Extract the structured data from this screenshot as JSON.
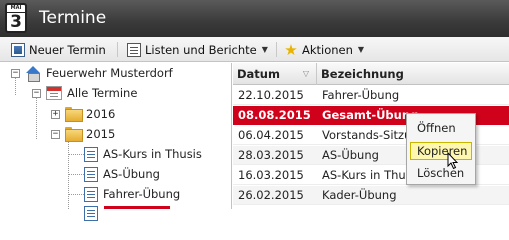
{
  "window": {
    "title": "Termine",
    "app_icon": {
      "month": "MAI",
      "day": "3"
    }
  },
  "toolbar": {
    "new_label": "Neuer Termin",
    "lists_label": "Listen und Berichte",
    "actions_label": "Aktionen"
  },
  "tree": {
    "items": [
      {
        "label": "Feuerwehr Musterdorf",
        "icon": "home-icon"
      },
      {
        "label": "Alle Termine",
        "icon": "calendar-icon"
      },
      {
        "label": "2016",
        "icon": "folder-icon"
      },
      {
        "label": "2015",
        "icon": "folder-open-icon"
      },
      {
        "label": "AS-Kurs in Thusis",
        "icon": "document-icon"
      },
      {
        "label": "AS-Übung",
        "icon": "document-icon"
      },
      {
        "label": "Fahrer-Übung",
        "icon": "document-icon"
      }
    ]
  },
  "grid": {
    "columns": [
      "Datum",
      "Bezeichnung"
    ],
    "rows": [
      [
        "22.10.2015",
        "Fahrer-Übung"
      ],
      [
        "08.08.2015",
        "Gesamt-Übung"
      ],
      [
        "06.04.2015",
        "Vorstands-Sitzung"
      ],
      [
        "28.03.2015",
        "AS-Übung"
      ],
      [
        "16.03.2015",
        "AS-Kurs in Thusis"
      ],
      [
        "26.02.2015",
        "Kader-Übung"
      ]
    ],
    "selected_index": 1
  },
  "context_menu": {
    "items": [
      "Öffnen",
      "Kopieren",
      "Löschen"
    ],
    "highlighted_index": 1
  },
  "colors": {
    "accent": "#d0021b",
    "titlebar": "#3a3a3a",
    "menu_highlight": "#fdf7b0"
  }
}
